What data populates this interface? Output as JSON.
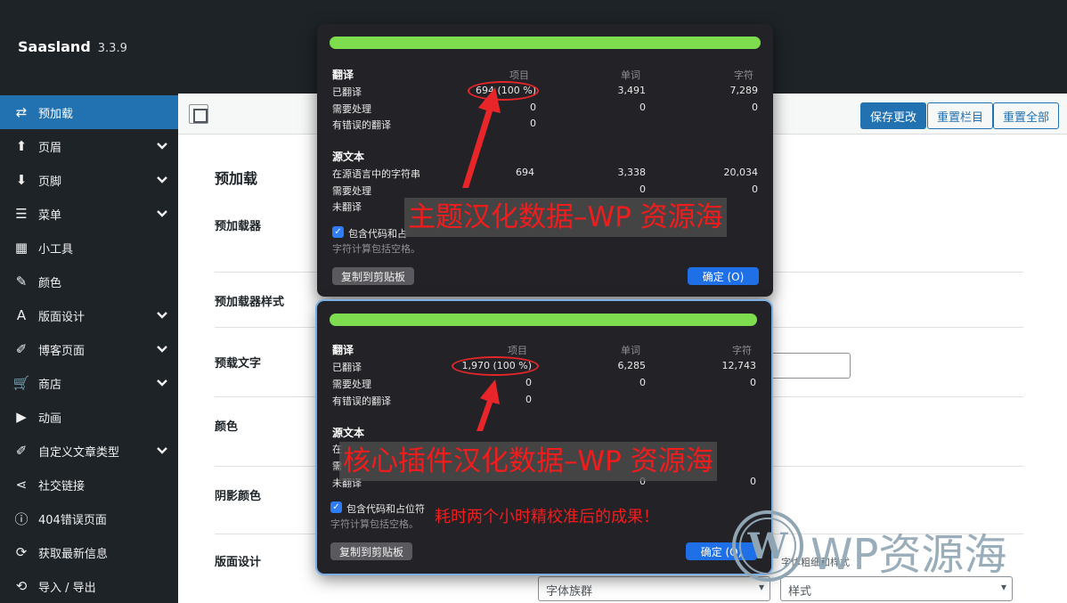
{
  "app": {
    "name": "Saasland",
    "version": "3.3.9"
  },
  "sidebar": {
    "items": [
      {
        "label": "预加载",
        "icon": "swap-arrows-icon",
        "glyph": "⇄",
        "expandable": false,
        "active": true
      },
      {
        "label": "页眉",
        "icon": "arrow-up-icon",
        "glyph": "⬆",
        "expandable": true,
        "active": false
      },
      {
        "label": "页脚",
        "icon": "arrow-down-icon",
        "glyph": "⬇",
        "expandable": true,
        "active": false
      },
      {
        "label": "菜单",
        "icon": "menu-icon",
        "glyph": "☰",
        "expandable": true,
        "active": false
      },
      {
        "label": "小工具",
        "icon": "widgets-icon",
        "glyph": "▦",
        "expandable": false,
        "active": false
      },
      {
        "label": "颜色",
        "icon": "brush-icon",
        "glyph": "✎",
        "expandable": false,
        "active": false
      },
      {
        "label": "版面设计",
        "icon": "typography-icon",
        "glyph": "A",
        "expandable": true,
        "active": false
      },
      {
        "label": "博客页面",
        "icon": "pin-icon",
        "glyph": "✐",
        "expandable": true,
        "active": false
      },
      {
        "label": "商店",
        "icon": "cart-icon",
        "glyph": "🛒",
        "expandable": true,
        "active": false
      },
      {
        "label": "动画",
        "icon": "play-icon",
        "glyph": "▶",
        "expandable": false,
        "active": false
      },
      {
        "label": "自定义文章类型",
        "icon": "pin-icon",
        "glyph": "✐",
        "expandable": true,
        "active": false
      },
      {
        "label": "社交链接",
        "icon": "share-icon",
        "glyph": "⋖",
        "expandable": false,
        "active": false
      },
      {
        "label": "404错误页面",
        "icon": "info-icon",
        "glyph": "ⓘ",
        "expandable": false,
        "active": false
      },
      {
        "label": "获取最新信息",
        "icon": "refresh-icon",
        "glyph": "⟳",
        "expandable": false,
        "active": false
      },
      {
        "label": "导入 / 导出",
        "icon": "sync-icon",
        "glyph": "⟲",
        "expandable": false,
        "active": false
      }
    ]
  },
  "toolbar": {
    "save": "保存更改",
    "reset_section": "重置栏目",
    "reset_all": "重置全部"
  },
  "main": {
    "section_title": "预加载",
    "fields": [
      "预加载器",
      "预加载器样式",
      "预载文字",
      "颜色",
      "阴影颜色",
      "版面设计"
    ],
    "font_family_placeholder": "字体族群",
    "font_style_label": "字体粗细和样式",
    "style_placeholder": "样式"
  },
  "dialogs": [
    {
      "headers": {
        "translation": "翻译",
        "items": "项目",
        "words": "单词",
        "chars": "字符"
      },
      "rows": [
        {
          "label": "已翻译",
          "items": "694 (100 %)",
          "words": "3,491",
          "chars": "7,289"
        },
        {
          "label": "需要处理",
          "items": "0",
          "words": "0",
          "chars": "0"
        },
        {
          "label": "有错误的翻译",
          "items": "0",
          "words": "",
          "chars": ""
        }
      ],
      "source_title": "源文本",
      "source_rows": [
        {
          "label": "在源语言中的字符串",
          "items": "694",
          "words": "3,338",
          "chars": "20,034"
        },
        {
          "label": "需要处理",
          "items": "",
          "words": "0",
          "chars": "0"
        },
        {
          "label": "未翻译",
          "items": "",
          "words": "",
          "chars": ""
        }
      ],
      "checkbox_label": "包含代码和占",
      "note": "字符计算包括空格。",
      "copy_button": "复制到剪贴板",
      "ok_button": "确定 (O)"
    },
    {
      "headers": {
        "translation": "翻译",
        "items": "项目",
        "words": "单词",
        "chars": "字符"
      },
      "rows": [
        {
          "label": "已翻译",
          "items": "1,970 (100 %)",
          "words": "6,285",
          "chars": "12,743"
        },
        {
          "label": "需要处理",
          "items": "0",
          "words": "0",
          "chars": "0"
        },
        {
          "label": "有错误的翻译",
          "items": "0",
          "words": "",
          "chars": ""
        }
      ],
      "source_title": "源文本",
      "source_rows": [
        {
          "label": "在",
          "items": "",
          "words": "",
          "chars": ""
        },
        {
          "label": "需",
          "items": "",
          "words": "",
          "chars": ""
        },
        {
          "label": "未翻译",
          "items": "",
          "words": "0",
          "chars": "0"
        }
      ],
      "checkbox_label": "包含代码和占位符",
      "note": "字符计算包括空格。",
      "copy_button": "复制到剪贴板",
      "ok_button": "确定 (O)"
    }
  ],
  "overlays": {
    "banner1": "主题汉化数据–WP 资源海",
    "banner2": "核心插件汉化数据–WP 资源海",
    "caption": "耗时两个小时精校准后的成果！",
    "watermark": "WP资源海"
  },
  "colors": {
    "progress": "#7ddd4f",
    "accent": "#2271b1",
    "annotation": "#f31c1c"
  }
}
